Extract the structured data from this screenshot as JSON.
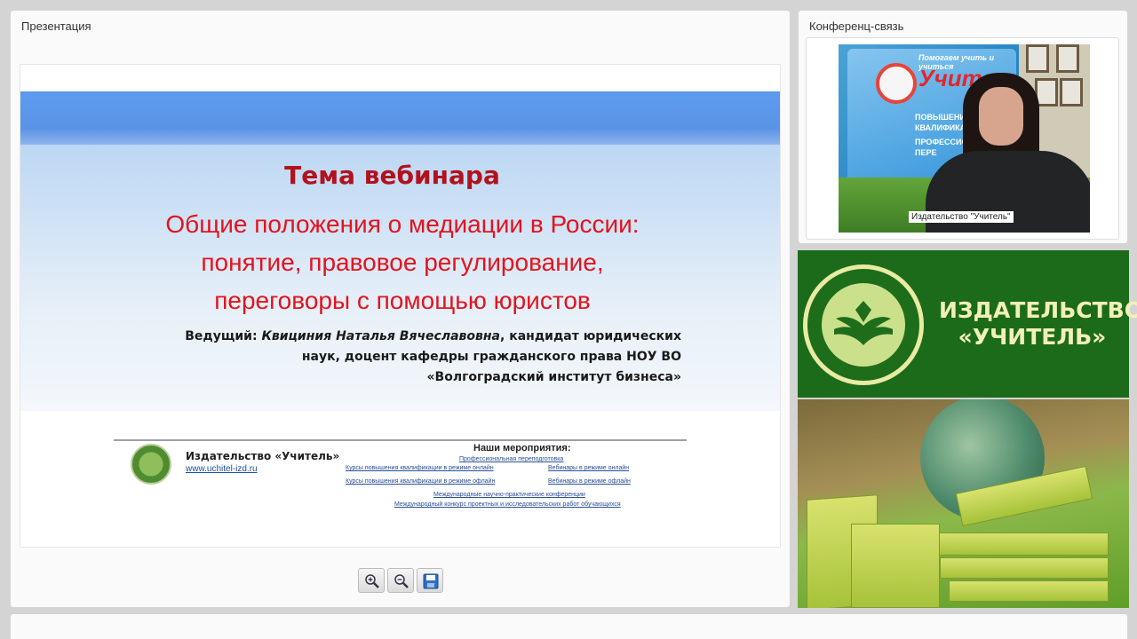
{
  "presentation": {
    "title": "Презентация",
    "slide": {
      "heading": "Тема вебинара",
      "topic_lines": [
        "Общие положения о медиации в России:",
        "понятие, правовое регулирование,",
        "переговоры с помощью юристов"
      ],
      "host_prefix": "Ведущий: ",
      "host_name": "Квициния Наталья Вячеславовна",
      "host_line1_rest": ", кандидат юридических",
      "host_line2": "наук, доцент кафедры гражданского права НОУ ВО",
      "host_line3": "«Волгоградский институт бизнеса»",
      "footer": {
        "publisher": "Издательство «Учитель»",
        "url": "www.uchitel-izd.ru",
        "events_title": "Наши мероприятия",
        "events": [
          "Профессиональная переподготовка",
          "Курсы повышения квалификации в режиме онлайн",
          "Вебинары в режиме онлайн",
          "Курсы повышения квалификации в режиме офлайн",
          "Вебинары в режиме офлайн",
          "Международные научно-практические конференции",
          "Международный конкурс проектных и исследовательских работ обучающихся"
        ]
      }
    },
    "toolbar": {
      "zoom_in": "zoom-in-icon",
      "zoom_out": "zoom-out-icon",
      "save": "save-icon"
    }
  },
  "conference": {
    "title": "Конференц-связь",
    "participant_label": "Издательство \"Учитель\"",
    "video_backdrop": {
      "brand": "Учитель",
      "tagline": "Помогаем учить и учиться",
      "points": [
        "ПОВЫШЕНИЕ",
        "КВАЛИФИКАЦИИ",
        "ПРОФЕССИОНАЛ",
        "ПЕРЕ"
      ]
    }
  },
  "banner": {
    "line1": "ИЗДАТЕЛЬСТВО",
    "line2": "«УЧИТЕЛЬ»"
  },
  "colors": {
    "slide_heading": "#b1121d",
    "slide_topic": "#e2141e",
    "banner_green": "#1c6b1a",
    "banner_text": "#f2f0b8"
  }
}
